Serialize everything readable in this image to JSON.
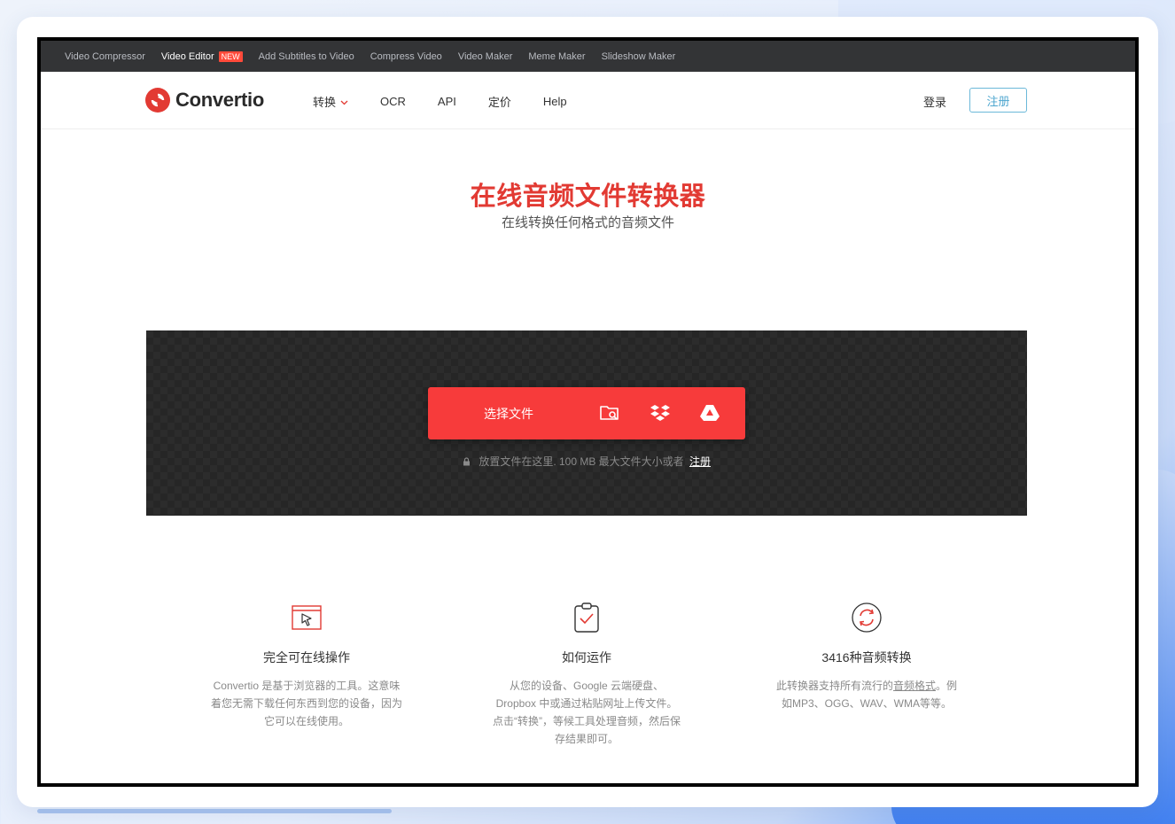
{
  "topbar": {
    "links": [
      {
        "label": "Video Compressor"
      },
      {
        "label": "Video Editor",
        "badge": "NEW"
      },
      {
        "label": "Add Subtitles to Video"
      },
      {
        "label": "Compress Video"
      },
      {
        "label": "Video Maker"
      },
      {
        "label": "Meme Maker"
      },
      {
        "label": "Slideshow Maker"
      }
    ]
  },
  "header": {
    "logo_text": "Convertio",
    "nav": [
      {
        "label": "转换"
      },
      {
        "label": "OCR"
      },
      {
        "label": "API"
      },
      {
        "label": "定价"
      },
      {
        "label": "Help"
      }
    ],
    "login": "登录",
    "signup": "注册"
  },
  "hero": {
    "title": "在线音频文件转换器",
    "subtitle": "在线转换任何格式的音频文件"
  },
  "upload": {
    "choose_label": "选择文件",
    "note": "放置文件在这里. 100 MB 最大文件大小或者",
    "note_link": "注册",
    "sources": [
      "folder-search-icon",
      "dropbox-icon",
      "google-drive-icon"
    ]
  },
  "features": [
    {
      "icon": "cursor-window-icon",
      "title": "完全可在线操作",
      "text": "Convertio 是基于浏览器的工具。这意味着您无需下载任何东西到您的设备，因为它可以在线使用。"
    },
    {
      "icon": "clipboard-check-icon",
      "title": "如何运作",
      "text": "从您的设备、Google 云端硬盘、Dropbox 中或通过粘贴网址上传文件。点击“转换”，等候工具处理音频，然后保存结果即可。"
    },
    {
      "icon": "refresh-circle-icon",
      "title": "3416种音频转换",
      "text_before": "此转换器支持所有流行的",
      "text_link": "音频格式",
      "text_after": "。例如MP3、OGG、WAV、WMA等等。"
    }
  ],
  "colors": {
    "brand_red": "#e23a33",
    "button_red": "#f73b3b",
    "topbar_bg": "#333436",
    "signup_border": "#6bb8d9"
  }
}
